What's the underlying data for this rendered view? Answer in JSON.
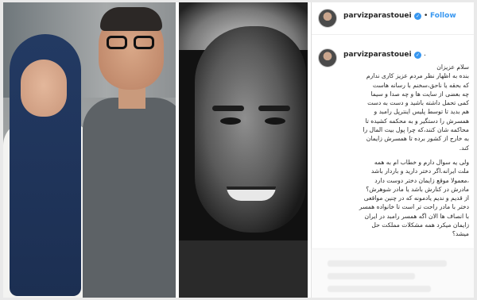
{
  "post": {
    "username": "parvizparastouei",
    "verified_icon": "verified-badge-icon",
    "follow_label": "Follow",
    "separator": "•",
    "comment_dot": "."
  },
  "caption_lines": [
    "سلام عزیزان",
    "بنده به اظهار نظر مردم عزیز کاری ندارم",
    "که بحقه یا ناحق،سخنم با رسانه هاست",
    "چه بعضی از سایت ها و چه صدا و سیما",
    "کمی تحمل داشته باشید و دست به دست",
    "هم بدید تا توسط پلیس اینترپل رامبد و",
    "همسرش را دستگیر و به محکمه کشیده تا",
    "محاکمه شان کنند،که چرا پول بیت المال را",
    "به خارج از کشور برده تا همسرش زایمان",
    "کند.",
    "",
    "ولی یه سوال دارم و خطاب ام به همه",
    "ملت ایرانه.اگر دختر دارید و باردار باشد",
    "،معمولا موقع زایمان دختر دوست دارد",
    "مادرش در کنارش باشد یا مادر شوهرش؟",
    "از قدیم و ندیم یادمونه که در چنین مواقعی",
    "دختر با مادر راحت تر است تا خانواده همسر",
    "با انصاف ها الان اگه همسر رامبد در ایران",
    "زایمان میکرد همه مشکلات مملکت حل",
    "میشد؟"
  ],
  "colors": {
    "link_blue": "#3897f0",
    "text_dark": "#262626"
  }
}
